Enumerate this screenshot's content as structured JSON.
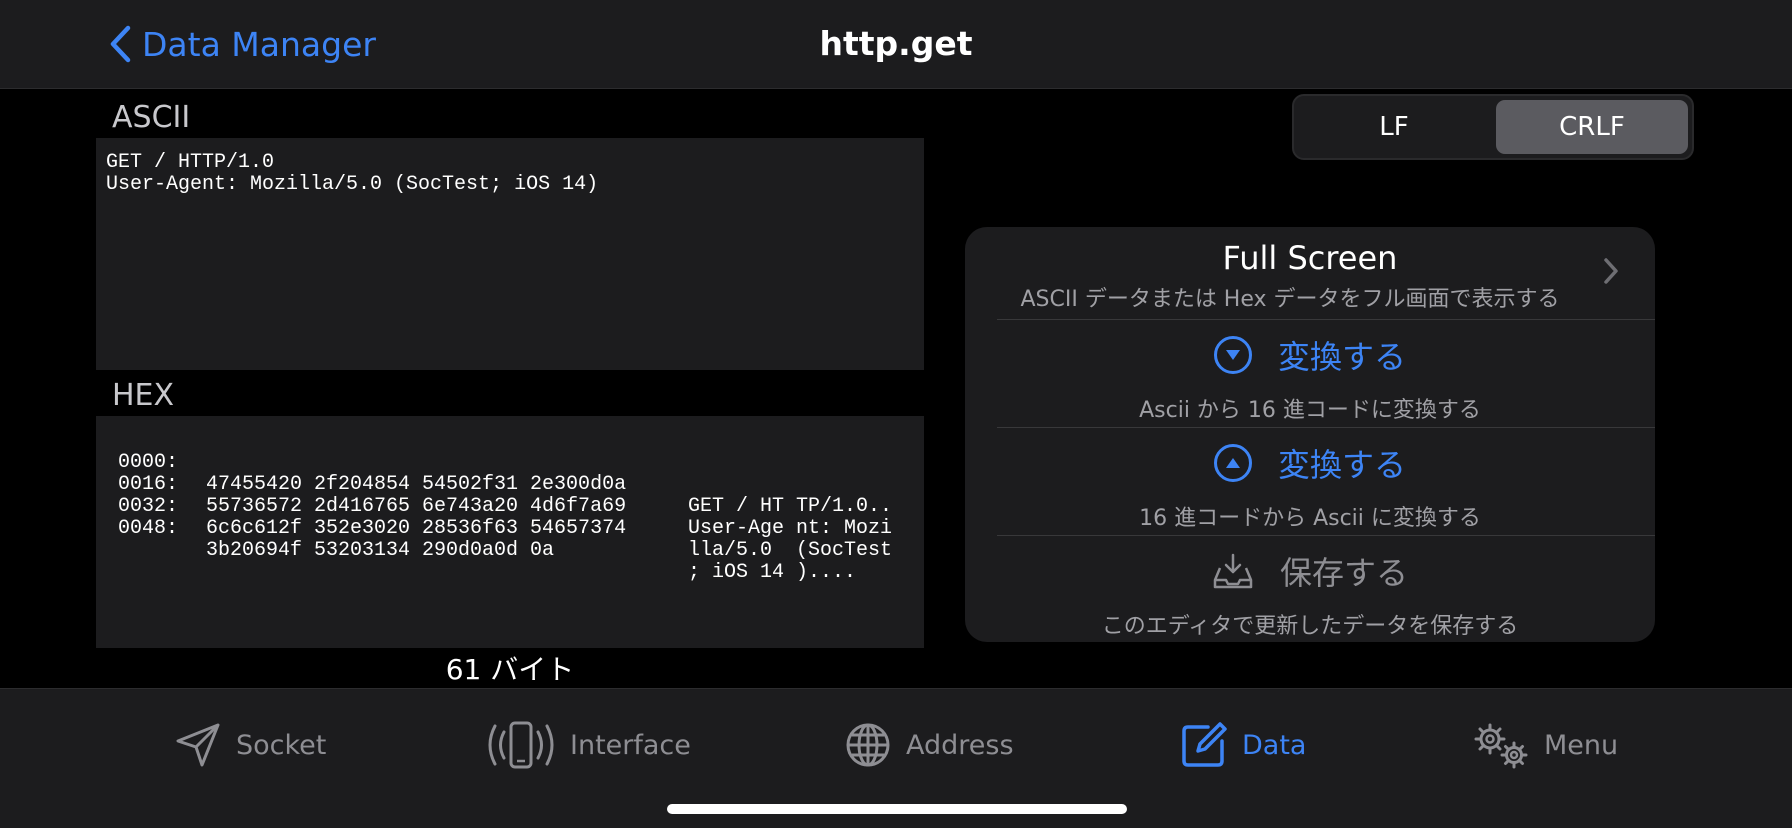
{
  "navbar": {
    "back_label": "Data Manager",
    "title": "http.get"
  },
  "ascii": {
    "heading": "ASCII",
    "lines": [
      "GET / HTTP/1.0",
      "User-Agent: Mozilla/5.0 (SocTest; iOS 14)"
    ]
  },
  "hex": {
    "heading": "HEX",
    "rows": [
      {
        "addr": "0000:",
        "data": "47455420 2f204854 54502f31 2e300d0a",
        "text": "GET / HT TP/1.0.."
      },
      {
        "addr": "0016:",
        "data": "55736572 2d416765 6e743a20 4d6f7a69",
        "text": "User-Age nt: Mozi"
      },
      {
        "addr": "0032:",
        "data": "6c6c612f 352e3020 28536f63 54657374",
        "text": "lla/5.0  (SocTest"
      },
      {
        "addr": "0048:",
        "data": "3b20694f 53203134 290d0a0d 0a",
        "text": "; iOS 14 )...."
      }
    ]
  },
  "byte_count": "61 バイト",
  "line_ending": {
    "options": [
      "LF",
      "CRLF"
    ],
    "selected": "CRLF"
  },
  "actions": {
    "full_screen": {
      "title": "Full Screen",
      "subtitle": "ASCII データまたは Hex データをフル画面で表示する"
    },
    "to_hex": {
      "label": "変換する",
      "subtitle": "Ascii から 16 進コードに変換する",
      "icon": "arrow-down-circle-icon"
    },
    "to_ascii": {
      "label": "変換する",
      "subtitle": "16 進コードから Ascii に変換する",
      "icon": "arrow-up-circle-icon"
    },
    "save": {
      "label": "保存する",
      "subtitle": "このエディタで更新したデータを保存する",
      "icon": "tray-download-icon",
      "enabled": false
    }
  },
  "tabs": [
    {
      "label": "Socket",
      "icon": "paperplane-icon"
    },
    {
      "label": "Interface",
      "icon": "phone-signal-icon"
    },
    {
      "label": "Address",
      "icon": "globe-icon"
    },
    {
      "label": "Data",
      "icon": "edit-icon",
      "active": true
    },
    {
      "label": "Menu",
      "icon": "gears-icon"
    }
  ],
  "colors": {
    "accent": "#3d84f5",
    "background": "#000000",
    "surface": "#1c1c1e"
  }
}
